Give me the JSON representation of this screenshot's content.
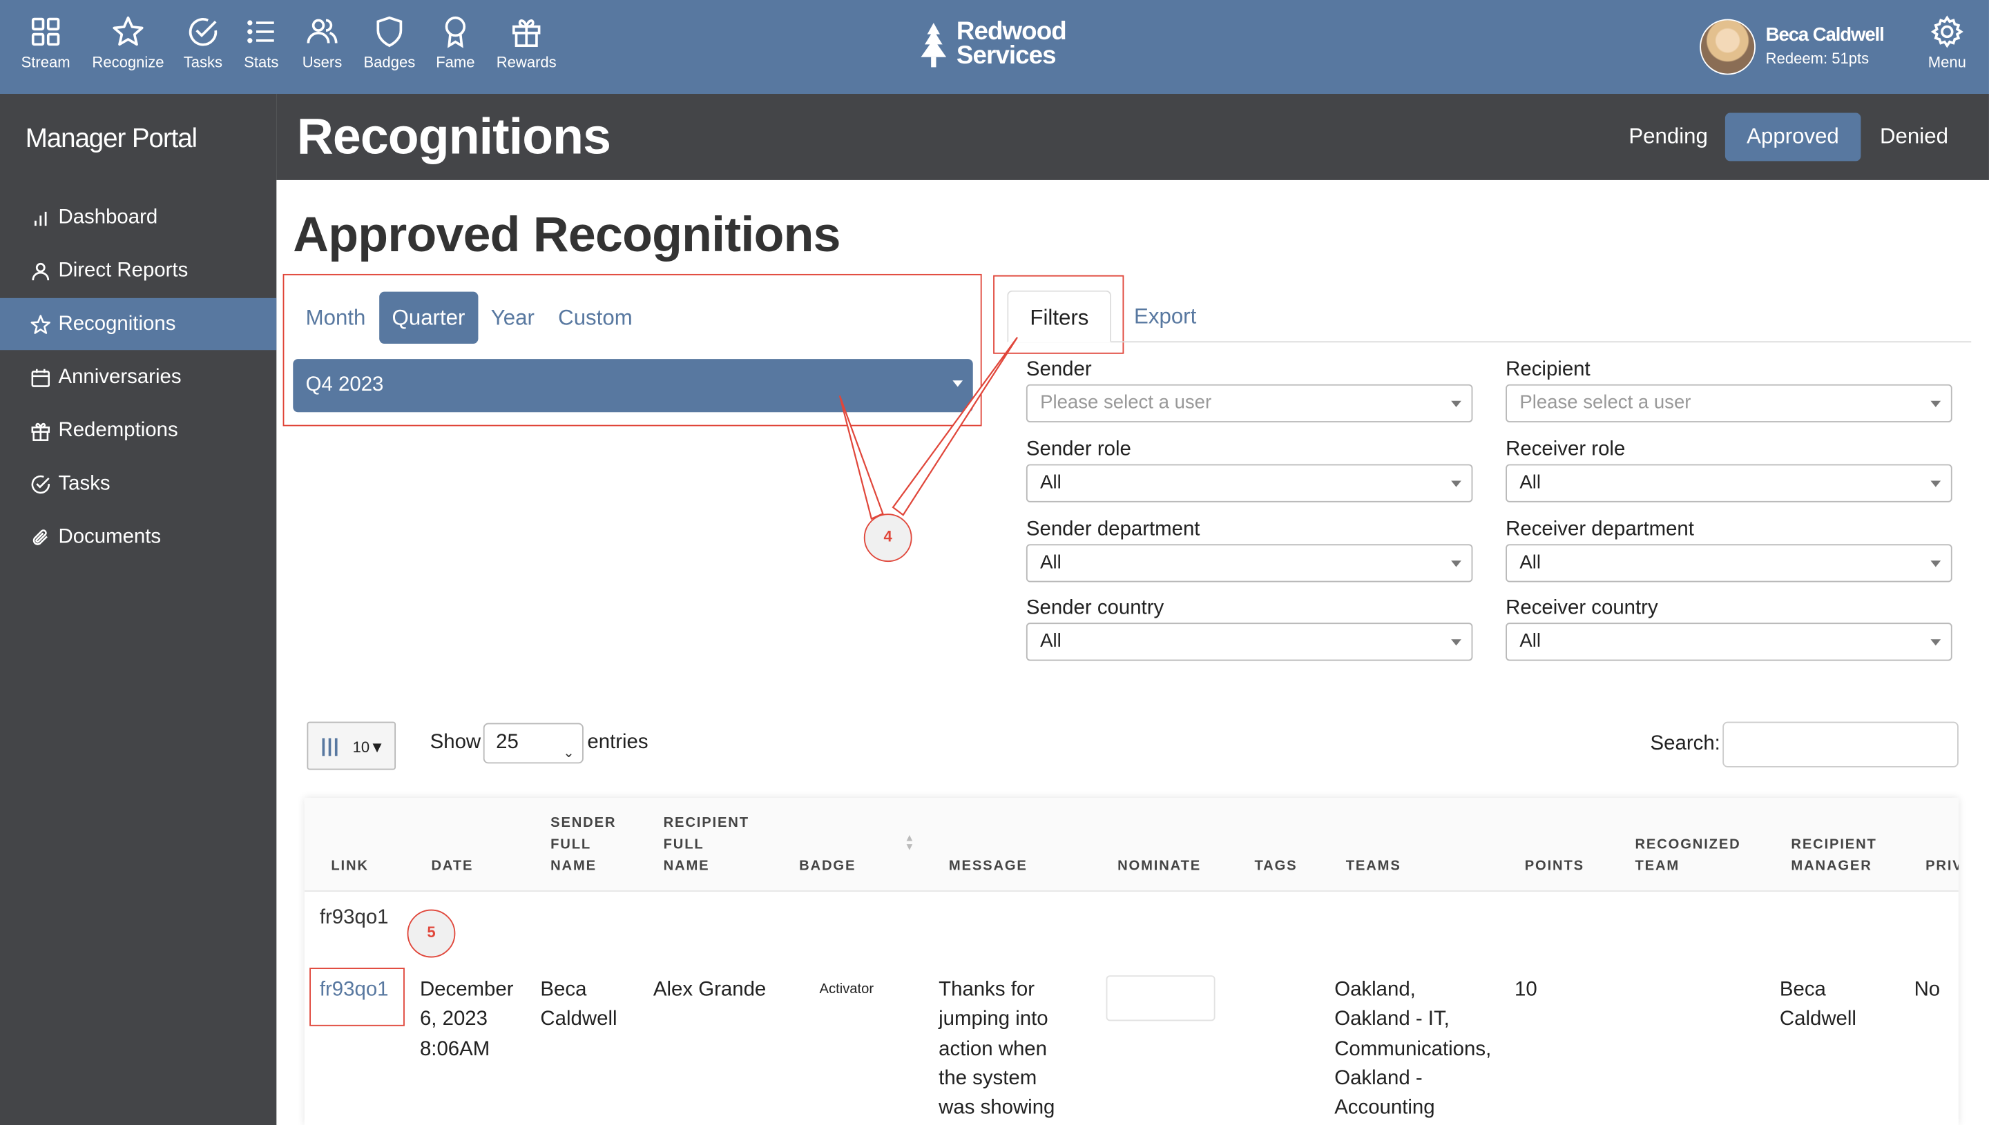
{
  "topnav": {
    "items": [
      {
        "label": "Stream",
        "icon": "grid-icon"
      },
      {
        "label": "Recognize",
        "icon": "star-icon"
      },
      {
        "label": "Tasks",
        "icon": "check-circle-icon"
      },
      {
        "label": "Stats",
        "icon": "list-icon"
      },
      {
        "label": "Users",
        "icon": "users-icon"
      },
      {
        "label": "Badges",
        "icon": "shield-icon"
      },
      {
        "label": "Fame",
        "icon": "award-icon"
      },
      {
        "label": "Rewards",
        "icon": "gift-icon"
      }
    ],
    "brand": {
      "line1": "Redwood",
      "line2": "Services"
    },
    "user": {
      "name": "Beca Caldwell",
      "points": "Redeem: 51pts"
    },
    "menu_label": "Menu"
  },
  "sidebar": {
    "title": "Manager Portal",
    "items": [
      {
        "label": "Dashboard",
        "icon": "bar-chart-icon"
      },
      {
        "label": "Direct Reports",
        "icon": "person-icon"
      },
      {
        "label": "Recognitions",
        "icon": "star-icon"
      },
      {
        "label": "Anniversaries",
        "icon": "calendar-icon"
      },
      {
        "label": "Redemptions",
        "icon": "gift-icon"
      },
      {
        "label": "Tasks",
        "icon": "check-circle-icon"
      },
      {
        "label": "Documents",
        "icon": "paperclip-icon"
      }
    ]
  },
  "header": {
    "title": "Recognitions",
    "tabs": [
      "Pending",
      "Approved",
      "Denied"
    ],
    "active_tab": "Approved"
  },
  "main": {
    "heading": "Approved Recognitions",
    "period_tabs": [
      "Month",
      "Quarter",
      "Year",
      "Custom"
    ],
    "active_period": "Quarter",
    "period_value": "Q4 2023",
    "filter_tabs": [
      "Filters",
      "Export"
    ],
    "filters": {
      "sender": {
        "label": "Sender",
        "placeholder": "Please select a user"
      },
      "recipient": {
        "label": "Recipient",
        "placeholder": "Please select a user"
      },
      "sender_role": {
        "label": "Sender role",
        "value": "All"
      },
      "receiver_role": {
        "label": "Receiver role",
        "value": "All"
      },
      "sender_department": {
        "label": "Sender department",
        "value": "All"
      },
      "receiver_department": {
        "label": "Receiver department",
        "value": "All"
      },
      "sender_country": {
        "label": "Sender country",
        "value": "All"
      },
      "receiver_country": {
        "label": "Receiver country",
        "value": "All"
      }
    },
    "callouts": {
      "one": "4",
      "two": "5"
    }
  },
  "table_controls": {
    "column_count": "10▼",
    "show_label": "Show",
    "show_value": "25",
    "entries_label": "entries",
    "search_label": "Search:"
  },
  "table": {
    "columns": [
      {
        "l1": "",
        "l2": "",
        "l3": "LINK"
      },
      {
        "l1": "",
        "l2": "",
        "l3": "DATE"
      },
      {
        "l1": "SENDER",
        "l2": "FULL",
        "l3": "NAME"
      },
      {
        "l1": "RECIPIENT",
        "l2": "FULL",
        "l3": "NAME"
      },
      {
        "l1": "",
        "l2": "",
        "l3": "BADGE"
      },
      {
        "l1": "",
        "l2": "",
        "l3": "MESSAGE"
      },
      {
        "l1": "",
        "l2": "",
        "l3": "NOMINATE"
      },
      {
        "l1": "",
        "l2": "",
        "l3": "TAGS"
      },
      {
        "l1": "",
        "l2": "",
        "l3": "TEAMS"
      },
      {
        "l1": "",
        "l2": "",
        "l3": "POINTS"
      },
      {
        "l1": "",
        "l2": "RECOGNIZED",
        "l3": "TEAM"
      },
      {
        "l1": "",
        "l2": "RECIPIENT",
        "l3": "MANAGER"
      },
      {
        "l1": "",
        "l2": "",
        "l3": "PRIV"
      }
    ],
    "group_label": "fr93qo1",
    "row": {
      "link": "fr93qo1",
      "date": [
        "December",
        "6, 2023",
        "8:06AM"
      ],
      "sender": [
        "Beca",
        "Caldwell"
      ],
      "recipient": "Alex Grande",
      "badge": "Activator",
      "message": [
        "Thanks for",
        "jumping into",
        "action when",
        "the system",
        "was showing"
      ],
      "teams": [
        "Oakland,",
        "Oakland - IT,",
        "Communications,",
        "Oakland -",
        "Accounting"
      ],
      "points": "10",
      "manager": [
        "Beca",
        "Caldwell"
      ],
      "private": "No"
    }
  },
  "colors": {
    "accent": "#5878a0",
    "dark": "#444548",
    "callout": "#e0463a"
  }
}
